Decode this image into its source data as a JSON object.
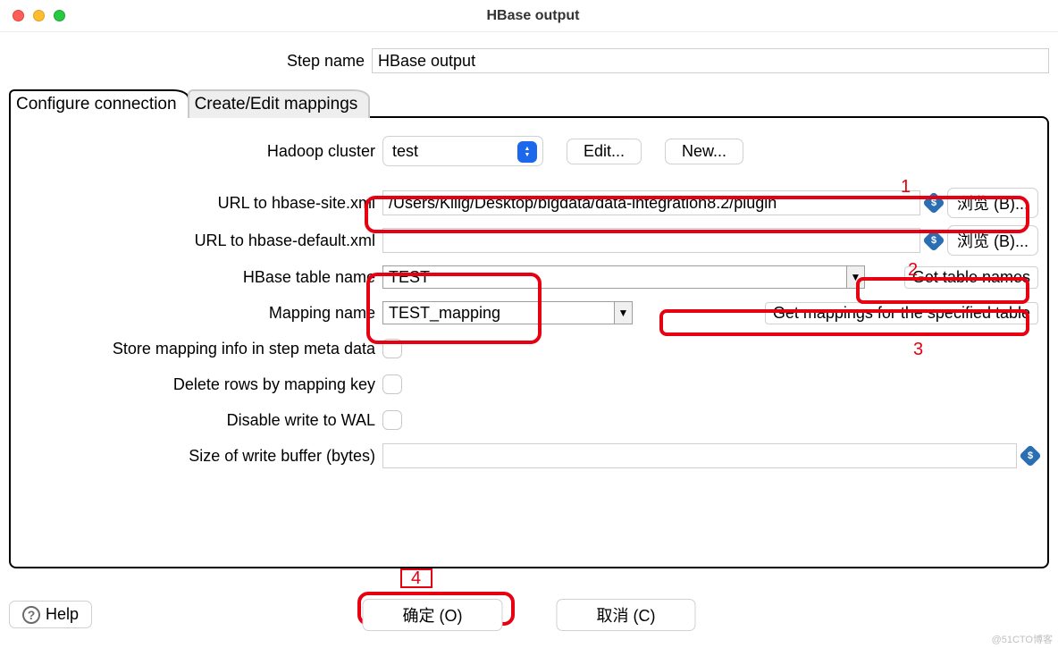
{
  "window": {
    "title": "HBase output"
  },
  "step": {
    "label": "Step name",
    "value": "HBase output"
  },
  "tabs": {
    "configure": "Configure connection",
    "mappings": "Create/Edit mappings"
  },
  "fields": {
    "hadoop_cluster": {
      "label": "Hadoop cluster",
      "value": "test",
      "edit": "Edit...",
      "new": "New..."
    },
    "hbase_site": {
      "label": "URL to hbase-site.xml",
      "value": "/Users/Kilig/Desktop/bigdata/data-integration8.2/plugin",
      "browse": "浏览 (B)..."
    },
    "hbase_default": {
      "label": "URL to hbase-default.xml",
      "value": "",
      "browse": "浏览 (B)..."
    },
    "table_name": {
      "label": "HBase table name",
      "value": "TEST",
      "button": "Get table names"
    },
    "mapping_name": {
      "label": "Mapping name",
      "value": "TEST_mapping",
      "button": "Get mappings for the specified table"
    },
    "store_meta": {
      "label": "Store mapping info in step meta data"
    },
    "delete_rows": {
      "label": "Delete rows by mapping key"
    },
    "disable_wal": {
      "label": "Disable write to WAL"
    },
    "buffer_size": {
      "label": "Size of write buffer (bytes)",
      "value": ""
    }
  },
  "annotations": {
    "n1": "1",
    "n2": "2",
    "n3": "3",
    "n4": "4"
  },
  "footer": {
    "help": "Help",
    "ok": "确定 (O)",
    "cancel": "取消 (C)"
  },
  "watermark": "@51CTO博客"
}
